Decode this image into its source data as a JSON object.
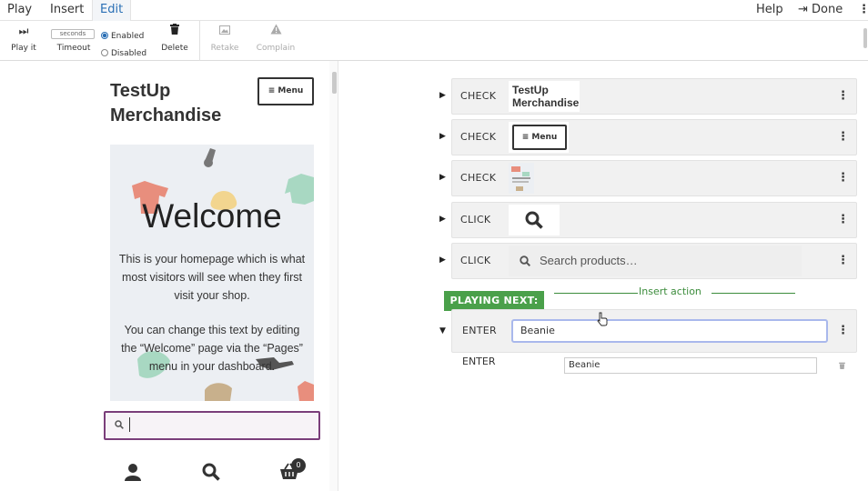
{
  "topbar": {
    "tabs": [
      {
        "label": "Play"
      },
      {
        "label": "Insert"
      },
      {
        "label": "Edit"
      }
    ],
    "help": "Help",
    "done": "Done",
    "more": "⋮"
  },
  "toolbar": {
    "play_it": "Play it",
    "timeout": "Timeout",
    "seconds_placeholder": "seconds",
    "enabled": "Enabled",
    "disabled": "Disabled",
    "delete": "Delete",
    "retake": "Retake",
    "complain": "Complain"
  },
  "preview": {
    "site_title": "TestUp Merchandise",
    "menu_label": "Menu",
    "hero_title": "Welcome",
    "hero_p1": "This is your homepage which is what most visitors will see when they first visit your shop.",
    "hero_p2": "You can change this text by editing the “Welcome” page via the “Pages” menu in your dashboard.",
    "cart_count": "0"
  },
  "steps": {
    "rows": [
      {
        "action": "CHECK",
        "preview": "TestUp Merchandise"
      },
      {
        "action": "CHECK",
        "preview": "Menu"
      },
      {
        "action": "CHECK",
        "preview": ""
      },
      {
        "action": "CLICK",
        "preview": ""
      },
      {
        "action": "CLICK",
        "preview": "Search products…"
      }
    ],
    "playing_next": "PLAYING NEXT:",
    "insert_action": "Insert action",
    "current": {
      "action": "ENTER",
      "value": "Beanie"
    },
    "sub": {
      "action": "ENTER",
      "value": "Beanie"
    }
  },
  "colors": {
    "accent": "#2a6fb5",
    "playing_next_bg": "#4aa04a",
    "insert_line": "#3c8c3c",
    "search_border": "#7a3e7a"
  }
}
